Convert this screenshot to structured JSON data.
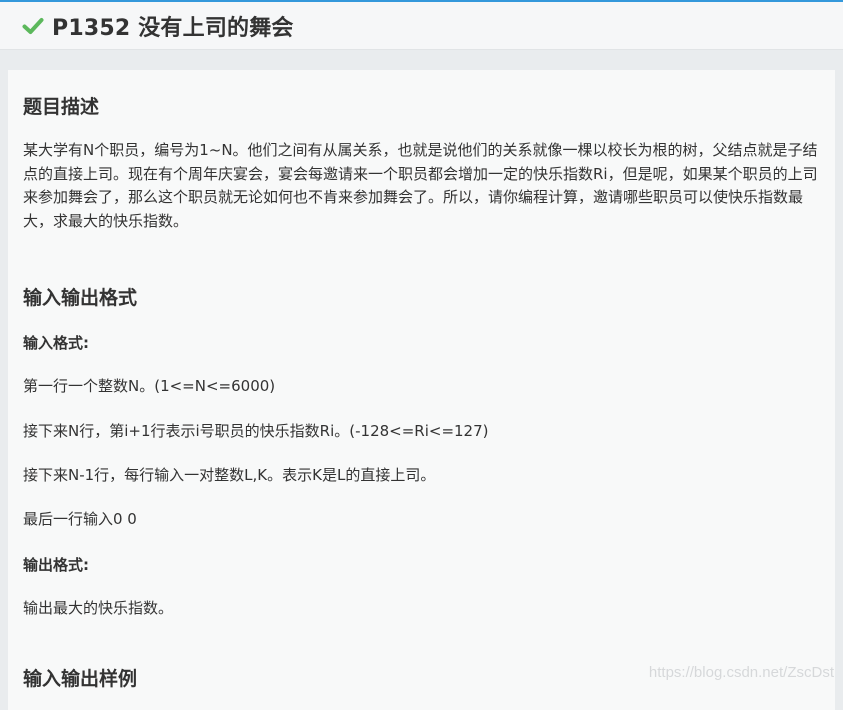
{
  "header": {
    "title": "P1352 没有上司的舞会",
    "status_icon": "check-icon",
    "status_color": "#5cb85c"
  },
  "description": {
    "heading": "题目描述",
    "text": "某大学有N个职员，编号为1~N。他们之间有从属关系，也就是说他们的关系就像一棵以校长为根的树，父结点就是子结点的直接上司。现在有个周年庆宴会，宴会每邀请来一个职员都会增加一定的快乐指数Ri，但是呢，如果某个职员的上司来参加舞会了，那么这个职员就无论如何也不肯来参加舞会了。所以，请你编程计算，邀请哪些职员可以使快乐指数最大，求最大的快乐指数。"
  },
  "io_format": {
    "heading": "输入输出格式",
    "input_label": "输入格式:",
    "input_lines": [
      "第一行一个整数N。(1<=N<=6000)",
      "接下来N行，第i+1行表示i号职员的快乐指数Ri。(-128<=Ri<=127)",
      "接下来N-1行，每行输入一对整数L,K。表示K是L的直接上司。",
      "最后一行输入0 0"
    ],
    "output_label": "输出格式:",
    "output_lines": [
      "输出最大的快乐指数。"
    ]
  },
  "samples": {
    "heading": "输入输出样例"
  },
  "watermark": "https://blog.csdn.net/ZscDst"
}
